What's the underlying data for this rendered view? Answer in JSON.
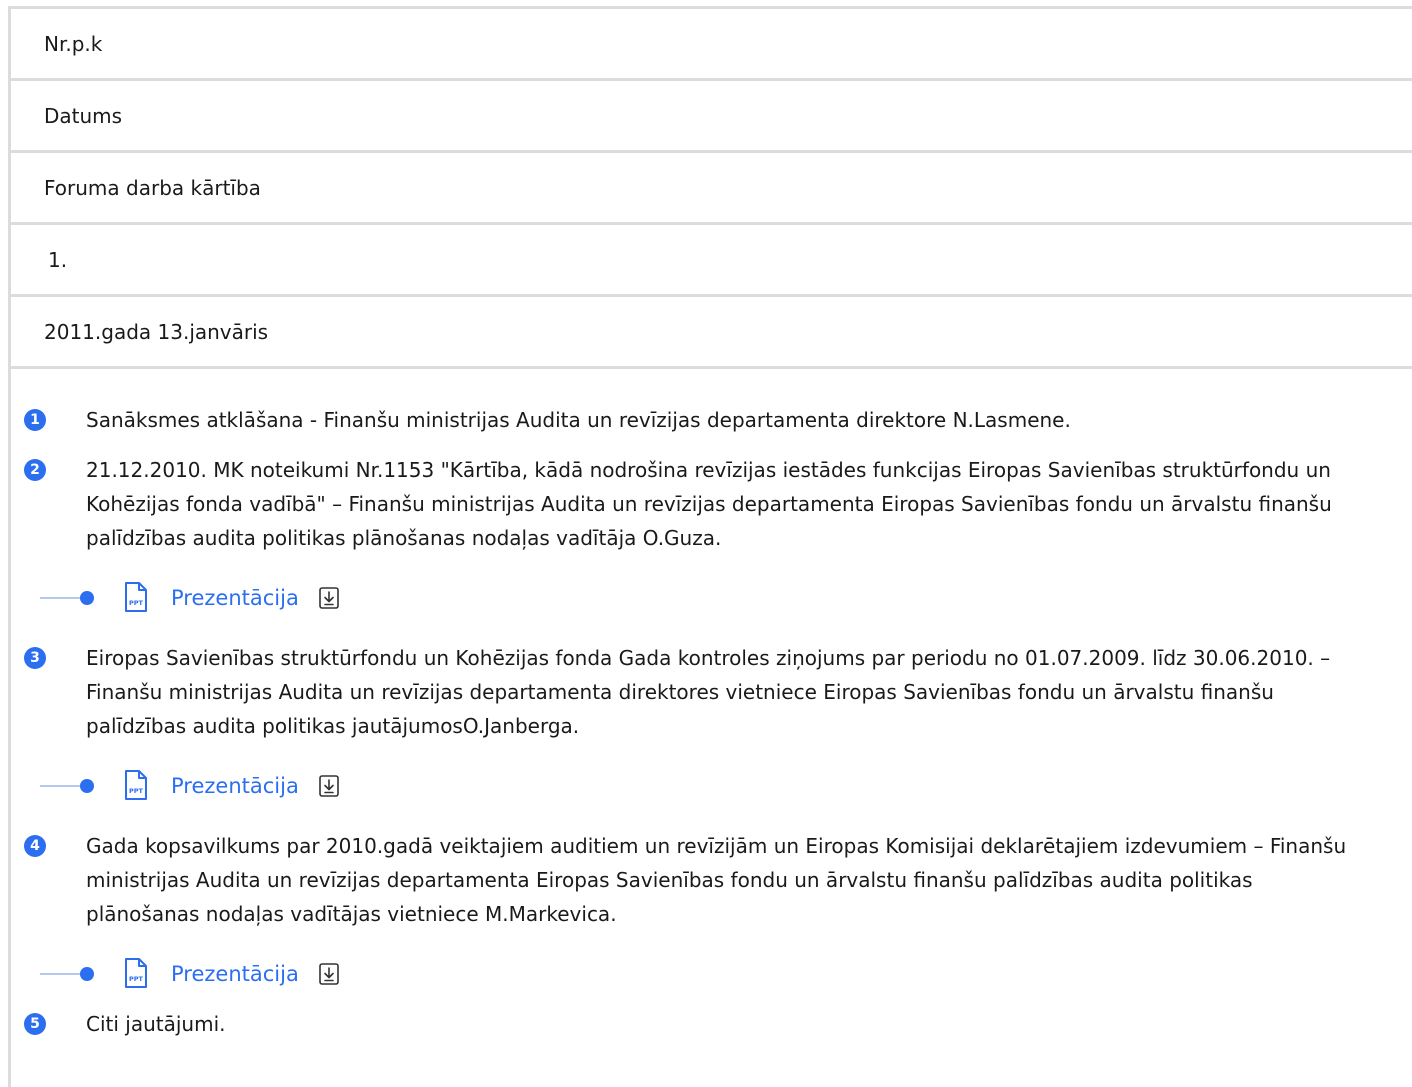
{
  "rows": {
    "col_nr": "Nr.p.k",
    "col_date": "Datums",
    "col_agenda": "Foruma darba kārtība",
    "row_nr": "1.",
    "row_date": "2011.gada 13.janvāris"
  },
  "agenda": [
    {
      "num": "1",
      "text": "Sanāksmes atklāšana - Finanšu ministrijas Audita un revīzijas departamenta  direktore N.Lasmene."
    },
    {
      "num": "2",
      "text": "21.12.2010. MK noteikumi Nr.1153 \"Kārtība, kādā nodrošina revīzijas iestādes funkcijas Eiropas Savienības struktūrfondu un Kohēzijas fonda vadībā\" – Finanšu ministrijas Audita un revīzijas departamenta  Eiropas Savienības fondu un ārvalstu finanšu palīdzības audita politikas plānošanas nodaļas vadītāja O.Guza.",
      "attachment": "Prezentācija"
    },
    {
      "num": "3",
      "text": "Eiropas Savienības struktūrfondu un Kohēzijas fonda Gada kontroles ziņojums par periodu no 01.07.2009. līdz 30.06.2010. – Finanšu ministrijas Audita un revīzijas departamenta  direktores vietniece Eiropas Savienības fondu un ārvalstu finanšu palīdzības audita politikas jautājumosO.Janberga.",
      "attachment": "Prezentācija"
    },
    {
      "num": "4",
      "text": "Gada kopsavilkums par 2010.gadā veiktajiem auditiem un revīzijām un Eiropas Komisijai deklarētajiem izdevumiem – Finanšu ministrijas Audita un revīzijas departamenta Eiropas Savienības fondu un ārvalstu finanšu palīdzības audita politikas plānošanas nodaļas vadītājas vietniece M.Markevica.",
      "attachment": "Prezentācija"
    },
    {
      "num": "5",
      "text": "Citi jautājumi."
    }
  ],
  "icons": {
    "file": "ppt-file-icon",
    "download": "download-icon"
  },
  "file_badge": "PPT",
  "colors": {
    "accent": "#2b6ff0",
    "border": "#dcdcdc"
  }
}
